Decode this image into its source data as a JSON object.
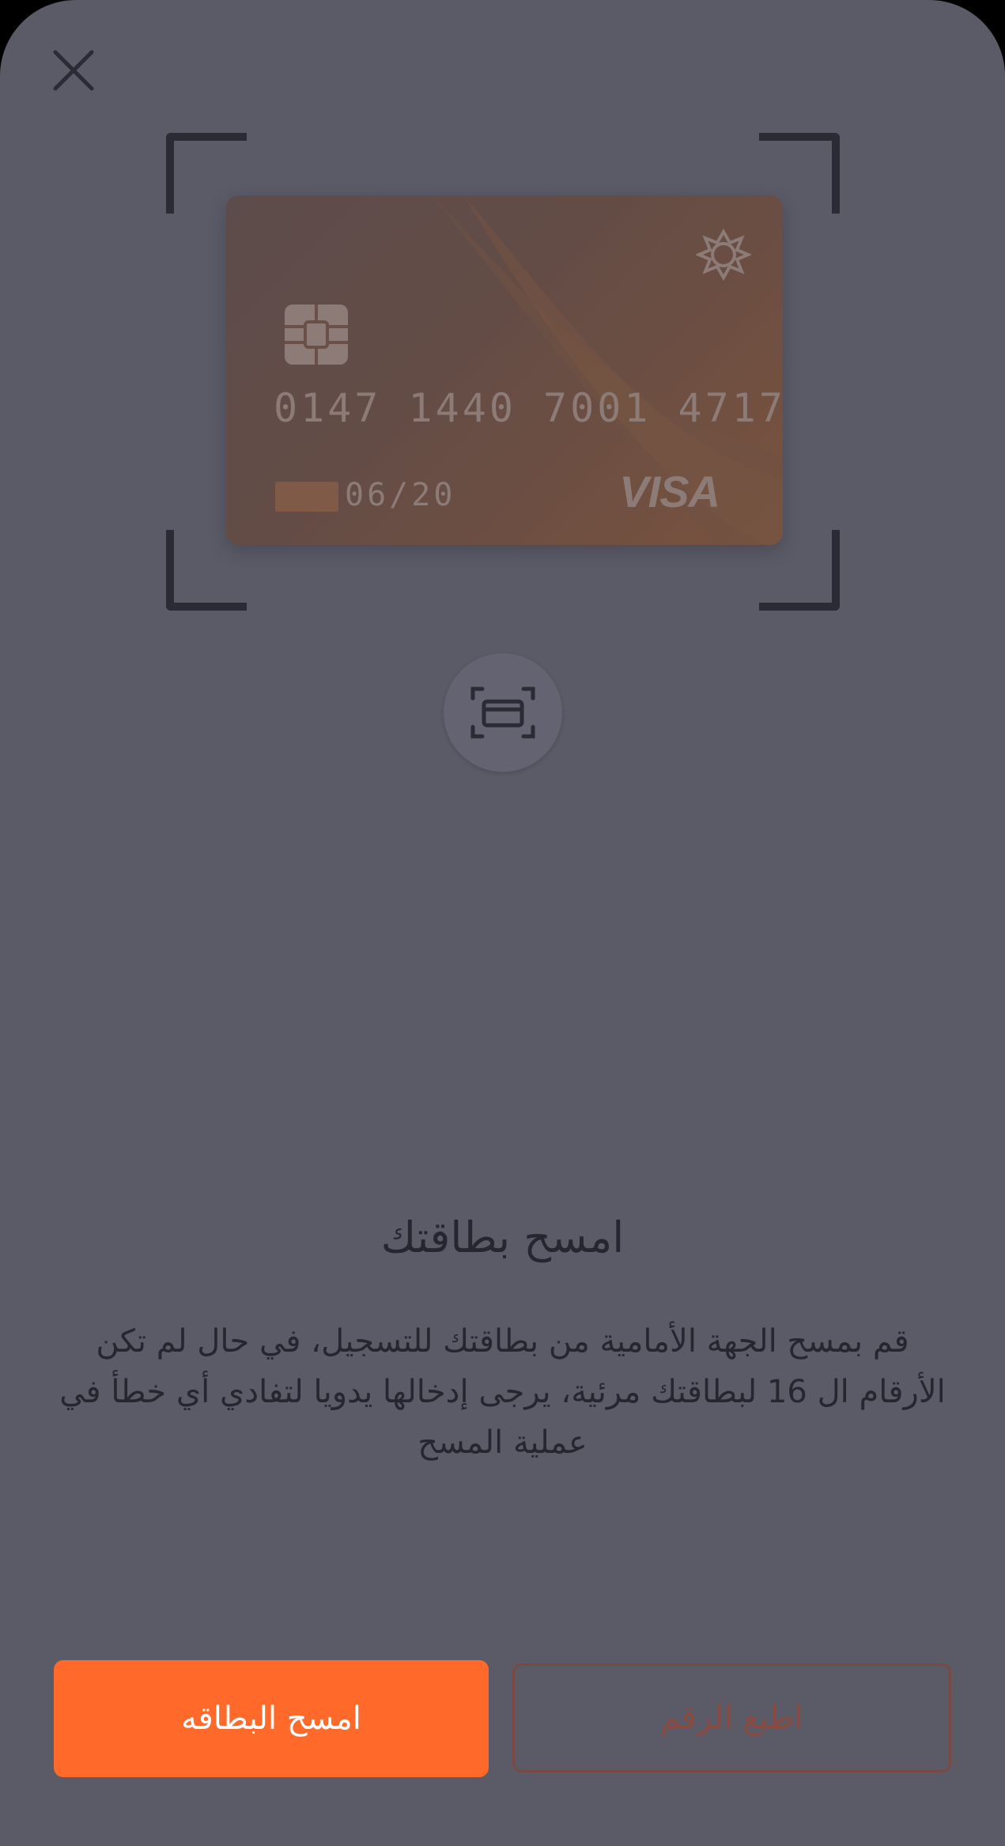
{
  "icons": {
    "close": "close-icon",
    "scan_toggle": "card-scan-icon",
    "chip": "chip-icon",
    "bank_logo": "bank-logo-icon"
  },
  "card": {
    "number": "0147 1440 7001 4717",
    "expiry": "06/20",
    "brand": "VISA"
  },
  "content": {
    "title": "امسح بطاقتك",
    "description": "قم بمسح الجهة الأمامية من بطاقتك للتسجيل، في حال لم تكن الأرقام ال 16 لبطاقتك مرئية، يرجى إدخالها يدويا لتفادي أي خطأ في عملية المسح"
  },
  "actions": {
    "scan_card_label": "امسح البطاقه",
    "type_number_label": "اطبع الرقم"
  },
  "colors": {
    "background": "#5b5b68",
    "accent": "#ff6a2b",
    "text": "#262630",
    "outline_button": "#7a4a42"
  }
}
